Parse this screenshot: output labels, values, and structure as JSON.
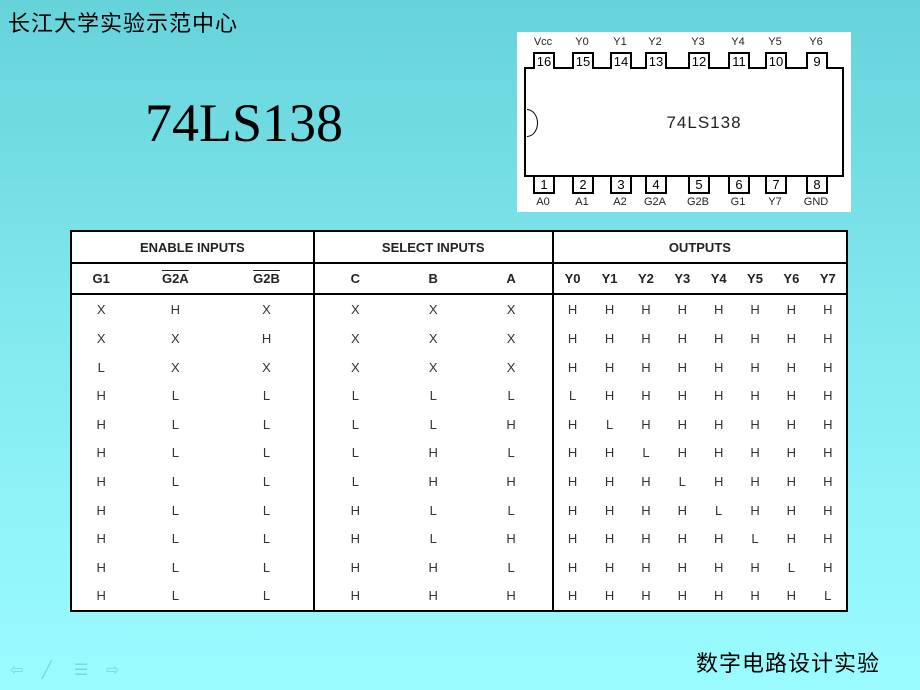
{
  "slide": {
    "header": "长江大学实验示范中心",
    "title": "74LS138",
    "footer": "数字电路设计实验"
  },
  "nav": {
    "icons": [
      "back-arrow-icon",
      "pen-icon",
      "menu-icon",
      "forward-arrow-icon"
    ],
    "glyphs": [
      "⇦",
      "╱",
      "☰",
      "⇨"
    ]
  },
  "chip": {
    "name": "74LS138",
    "top_pins": [
      {
        "num": "16",
        "label": "Vcc"
      },
      {
        "num": "15",
        "label": "Y0"
      },
      {
        "num": "14",
        "label": "Y1"
      },
      {
        "num": "13",
        "label": "Y2"
      },
      {
        "num": "12",
        "label": "Y3"
      },
      {
        "num": "11",
        "label": "Y4"
      },
      {
        "num": "10",
        "label": "Y5"
      },
      {
        "num": "9",
        "label": "Y6"
      }
    ],
    "bottom_pins": [
      {
        "num": "1",
        "label": "A0"
      },
      {
        "num": "2",
        "label": "A1"
      },
      {
        "num": "3",
        "label": "A2"
      },
      {
        "num": "4",
        "label": "G2A"
      },
      {
        "num": "5",
        "label": "G2B"
      },
      {
        "num": "6",
        "label": "G1"
      },
      {
        "num": "7",
        "label": "Y7"
      },
      {
        "num": "8",
        "label": "GND"
      }
    ]
  },
  "table": {
    "groups": [
      "ENABLE INPUTS",
      "SELECT INPUTS",
      "OUTPUTS"
    ],
    "columns": [
      "G1",
      "G2A",
      "G2B",
      "C",
      "B",
      "A",
      "Y0",
      "Y1",
      "Y2",
      "Y3",
      "Y4",
      "Y5",
      "Y6",
      "Y7"
    ],
    "rows": [
      [
        "X",
        "H",
        "X",
        "X",
        "X",
        "X",
        "H",
        "H",
        "H",
        "H",
        "H",
        "H",
        "H",
        "H"
      ],
      [
        "X",
        "X",
        "H",
        "X",
        "X",
        "X",
        "H",
        "H",
        "H",
        "H",
        "H",
        "H",
        "H",
        "H"
      ],
      [
        "L",
        "X",
        "X",
        "X",
        "X",
        "X",
        "H",
        "H",
        "H",
        "H",
        "H",
        "H",
        "H",
        "H"
      ],
      [
        "H",
        "L",
        "L",
        "L",
        "L",
        "L",
        "L",
        "H",
        "H",
        "H",
        "H",
        "H",
        "H",
        "H"
      ],
      [
        "H",
        "L",
        "L",
        "L",
        "L",
        "H",
        "H",
        "L",
        "H",
        "H",
        "H",
        "H",
        "H",
        "H"
      ],
      [
        "H",
        "L",
        "L",
        "L",
        "H",
        "L",
        "H",
        "H",
        "L",
        "H",
        "H",
        "H",
        "H",
        "H"
      ],
      [
        "H",
        "L",
        "L",
        "L",
        "H",
        "H",
        "H",
        "H",
        "H",
        "L",
        "H",
        "H",
        "H",
        "H"
      ],
      [
        "H",
        "L",
        "L",
        "H",
        "L",
        "L",
        "H",
        "H",
        "H",
        "H",
        "L",
        "H",
        "H",
        "H"
      ],
      [
        "H",
        "L",
        "L",
        "H",
        "L",
        "H",
        "H",
        "H",
        "H",
        "H",
        "H",
        "L",
        "H",
        "H"
      ],
      [
        "H",
        "L",
        "L",
        "H",
        "H",
        "L",
        "H",
        "H",
        "H",
        "H",
        "H",
        "H",
        "L",
        "H"
      ],
      [
        "H",
        "L",
        "L",
        "H",
        "H",
        "H",
        "H",
        "H",
        "H",
        "H",
        "H",
        "H",
        "H",
        "L"
      ]
    ]
  }
}
